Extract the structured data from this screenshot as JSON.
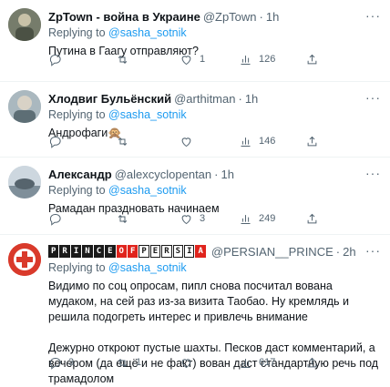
{
  "tweets": [
    {
      "name": "ZpTown - война в Украине",
      "handle": "@ZpTown",
      "time": "1h",
      "replying_prefix": "Replying to ",
      "replying_to": "@sasha_sotnik",
      "text": "Путина в Гаагу отправляют?",
      "replies": "",
      "retweets": "",
      "likes": "1",
      "views": "126"
    },
    {
      "name": "Хлодвиг Бульёнский",
      "handle": "@arthitman",
      "time": "1h",
      "replying_prefix": "Replying to ",
      "replying_to": "@sasha_sotnik",
      "text": "Андрофаги🙊",
      "replies": "",
      "retweets": "",
      "likes": "",
      "views": "146"
    },
    {
      "name": "Александр",
      "handle": "@alexcyclopentan",
      "time": "1h",
      "replying_prefix": "Replying to ",
      "replying_to": "@sasha_sotnik",
      "text": "Рамадан праздновать начинаем",
      "replies": "",
      "retweets": "",
      "likes": "3",
      "views": "249"
    },
    {
      "name_logo": [
        "P",
        "R",
        "I",
        "N",
        "C",
        "E",
        "O",
        "F",
        "P",
        "E",
        "R",
        "S",
        "I",
        "A"
      ],
      "handle": "@PERSIAN__PRINCE",
      "time": "2h",
      "replying_prefix": "Replying to ",
      "replying_to": "@sasha_sotnik",
      "text": "Видимо по соц опросам, пипл снова посчитал вована мудаком, на сей раз из-за визита Таобао. Ну кремлядь и решила подогреть интерес и привлечь внимание\n\nДежурно откроют пустые шахты. Песков даст комментарий, а вечером (да ещё и не факт) вован даст стандартную речь под трамадолом",
      "replies": "3",
      "retweets": "1",
      "likes": "",
      "views": "617"
    }
  ],
  "colors": {
    "accent": "#1d9bf0",
    "muted": "#536471",
    "text": "#0f1419"
  }
}
